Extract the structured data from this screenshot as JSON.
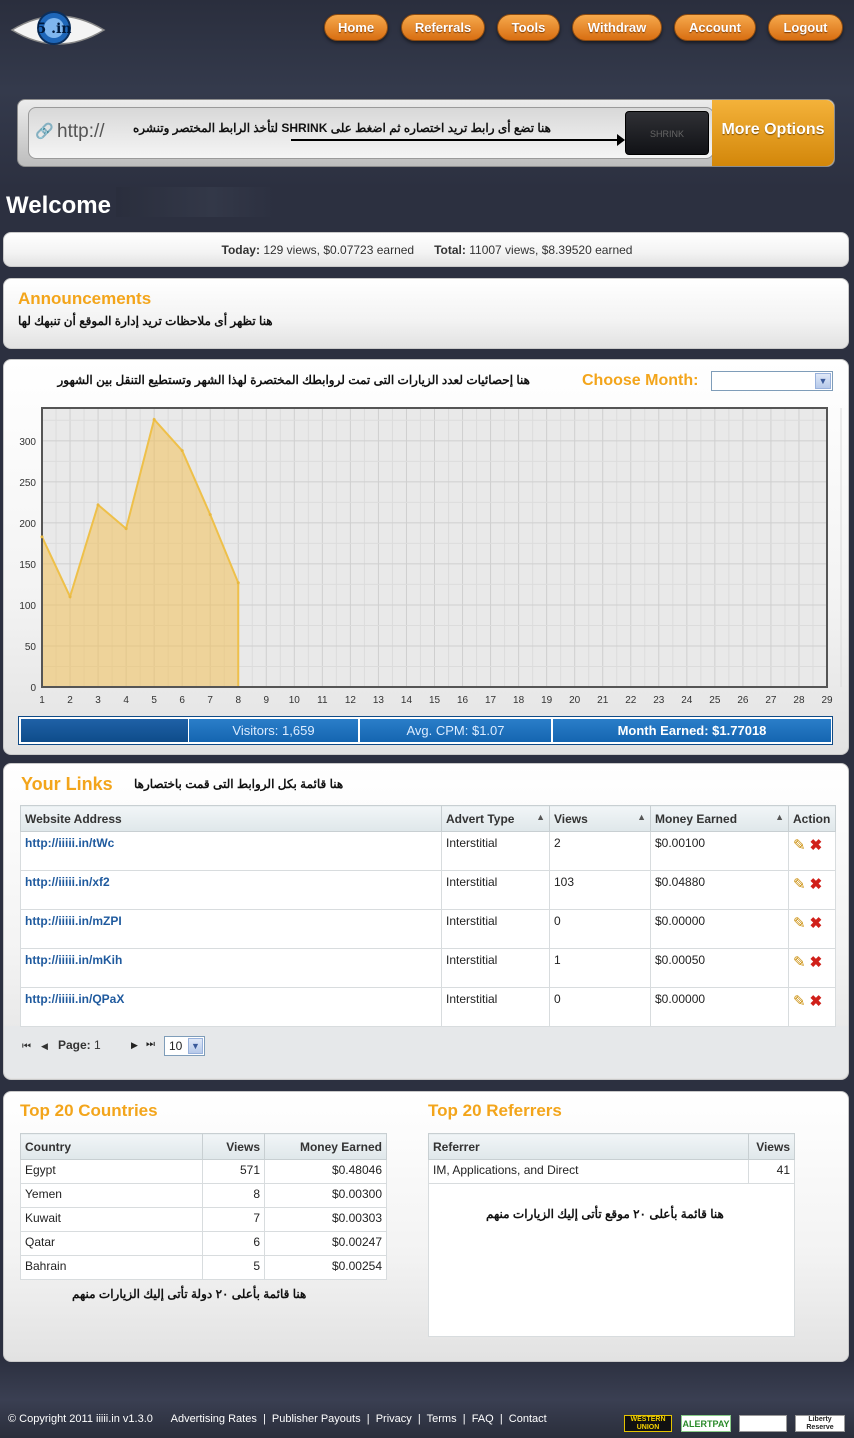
{
  "header": {
    "logo_text": "5 .in",
    "nav": [
      "Home",
      "Referrals",
      "Tools",
      "Withdraw",
      "Account",
      "Logout"
    ]
  },
  "shrink": {
    "prefix": "http://",
    "hint": "هنا تضع أى رابط تريد اختصاره ثم اضغط على SHRINK لتأخذ الرابط المختصر وتنشره",
    "button": "SHRINK",
    "more": "More Options"
  },
  "welcome": "Welcome",
  "stats": {
    "today_label": "Today:",
    "today_value": "129 views, $0.07723 earned",
    "total_label": "Total:",
    "total_value": "11007 views, $8.39520 earned"
  },
  "announcements": {
    "title": "Announcements",
    "text": "هنا تظهر أى ملاحظات تريد إدارة الموقع أن تنبهك لها"
  },
  "chart_section": {
    "note": "هنا إحصائيات لعدد الزيارات التى تمت لروابطك المختصرة لهذا الشهر وتستطيع التنقل بين الشهور",
    "choose_month": "Choose Month:",
    "month_value": ""
  },
  "chart_data": {
    "type": "area",
    "x": [
      1,
      2,
      3,
      4,
      5,
      6,
      7,
      8,
      9,
      10,
      11,
      12,
      13,
      14,
      15,
      16,
      17,
      18,
      19,
      20,
      21,
      22,
      23,
      24,
      25,
      26,
      27,
      28,
      29
    ],
    "values": [
      183,
      110,
      222,
      193,
      326,
      288,
      210,
      127
    ],
    "yticks": [
      0,
      50,
      100,
      150,
      200,
      250,
      300
    ],
    "ylim": [
      0,
      340
    ],
    "grid": true,
    "color": "#f2c15a"
  },
  "summary": {
    "visitors": "Visitors: 1,659",
    "cpm": "Avg. CPM: $1.07",
    "earned": "Month Earned: $1.77018"
  },
  "links": {
    "title": "Your Links",
    "note": "هنا قائمة بكل الروابط التى قمت باختصارها",
    "headers": [
      "Website Address",
      "Advert Type",
      "Views",
      "Money Earned",
      "Action"
    ],
    "rows": [
      [
        "http://iiiii.in/tWc",
        "Interstitial",
        "2",
        "$0.00100"
      ],
      [
        "http://iiiii.in/xf2",
        "Interstitial",
        "103",
        "$0.04880"
      ],
      [
        "http://iiiii.in/mZPI",
        "Interstitial",
        "0",
        "$0.00000"
      ],
      [
        "http://iiiii.in/mKih",
        "Interstitial",
        "1",
        "$0.00050"
      ],
      [
        "http://iiiii.in/QPaX",
        "Interstitial",
        "0",
        "$0.00000"
      ]
    ],
    "page_label": "Page:",
    "page": "1",
    "per_page": "10"
  },
  "countries": {
    "title": "Top 20 Countries",
    "headers": [
      "Country",
      "Views",
      "Money Earned"
    ],
    "rows": [
      [
        "Egypt",
        "571",
        "$0.48046"
      ],
      [
        "Yemen",
        "8",
        "$0.00300"
      ],
      [
        "Kuwait",
        "7",
        "$0.00303"
      ],
      [
        "Qatar",
        "6",
        "$0.00247"
      ],
      [
        "Bahrain",
        "5",
        "$0.00254"
      ]
    ],
    "note": "هنا قائمة بأعلى ٢٠ دولة تأتى إليك الزيارات منهم"
  },
  "referrers": {
    "title": "Top 20 Referrers",
    "headers": [
      "Referrer",
      "Views"
    ],
    "rows": [
      [
        "IM, Applications, and Direct",
        "41"
      ]
    ],
    "note": "هنا قائمة بأعلى ٢٠ موقع تأتى إليك الزيارات منهم"
  },
  "footer": {
    "copyright": "© Copyright 2011 iiiii.in v1.3.0",
    "links": [
      "Advertising Rates",
      "Publisher Payouts",
      "Privacy",
      "Terms",
      "FAQ",
      "Contact"
    ],
    "badges": [
      "WESTERN UNION",
      "ALERTPAY",
      "",
      "Liberty Reserve"
    ]
  }
}
